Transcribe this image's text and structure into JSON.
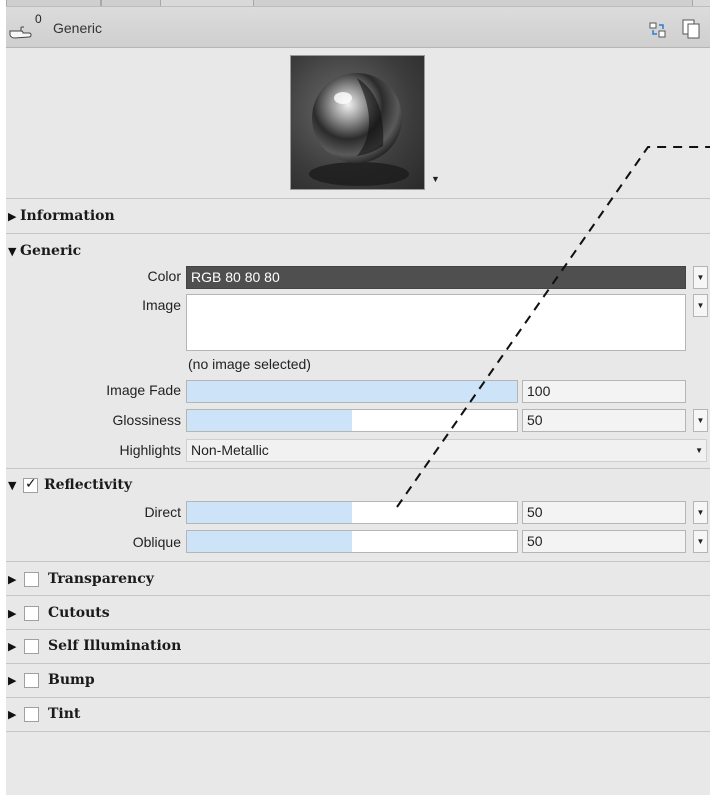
{
  "header": {
    "count": "0",
    "title": "Generic"
  },
  "sections": {
    "information": "Information",
    "generic": "Generic",
    "reflectivity": "Reflectivity",
    "transparency": "Transparency",
    "cutouts": "Cutouts",
    "self_illumination": "Self Illumination",
    "bump": "Bump",
    "tint": "Tint"
  },
  "generic": {
    "color_label": "Color",
    "color_value": "RGB 80 80 80",
    "image_label": "Image",
    "image_note": "(no image selected)",
    "image_fade_label": "Image Fade",
    "image_fade_value": "100",
    "image_fade_level": 1.0,
    "glossiness_label": "Glossiness",
    "glossiness_value": "50",
    "glossiness_level": 0.5,
    "highlights_label": "Highlights",
    "highlights_value": "Non-Metallic"
  },
  "reflectivity": {
    "checked": true,
    "direct_label": "Direct",
    "direct_value": "50",
    "direct_level": 0.5,
    "oblique_label": "Oblique",
    "oblique_value": "50",
    "oblique_level": 0.5
  },
  "toggles": {
    "transparency": false,
    "cutouts": false,
    "self_illumination": false,
    "bump": false,
    "tint": false
  },
  "colors": {
    "slider_fill": "#cde3f7",
    "color_swatch": "#4f4f4f"
  }
}
